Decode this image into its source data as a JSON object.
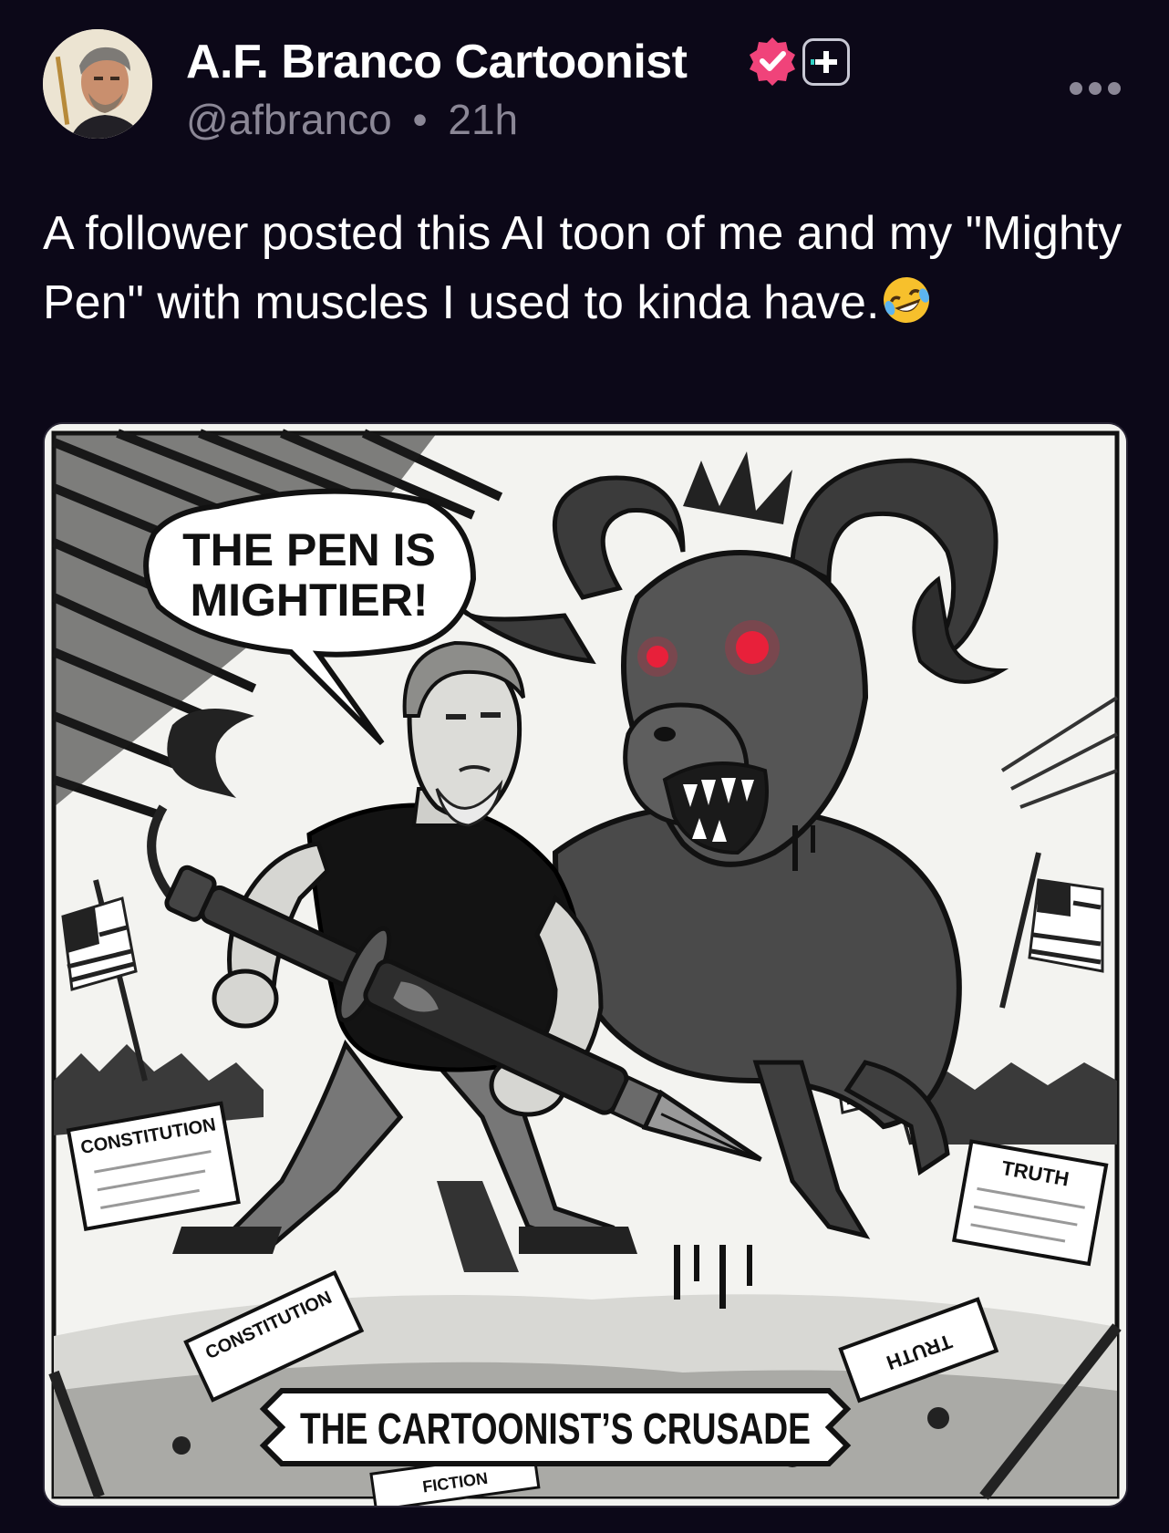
{
  "post": {
    "author": {
      "display_name": "A.F. Branco Cartoonist",
      "handle": "@afbranco",
      "separator": "•",
      "timestamp": "21h",
      "verified_icon": "verified-badge-icon",
      "verified_color": "#f0437a"
    },
    "text": "A follower posted this AI toon of me and my \"Mighty Pen\" with muscles I used to kinda have.",
    "emoji": "rolling-on-floor-laughing-emoji",
    "more_icon": "ellipsis-icon",
    "add_icon": "plus-icon"
  },
  "cartoon": {
    "speech_bubble": [
      "THE PEN IS",
      "MIGHTIER!"
    ],
    "banner": "THE CARTOONIST’S CRUSADE",
    "paper_left": "CONSTITUTION",
    "paper_right": "TRUTH",
    "paper_bottom_left": "CONSTITUTION",
    "paper_bottom_right": "TRUTH",
    "paper_fragment": "FICTION",
    "accent_eye_color": "#e8203a"
  }
}
